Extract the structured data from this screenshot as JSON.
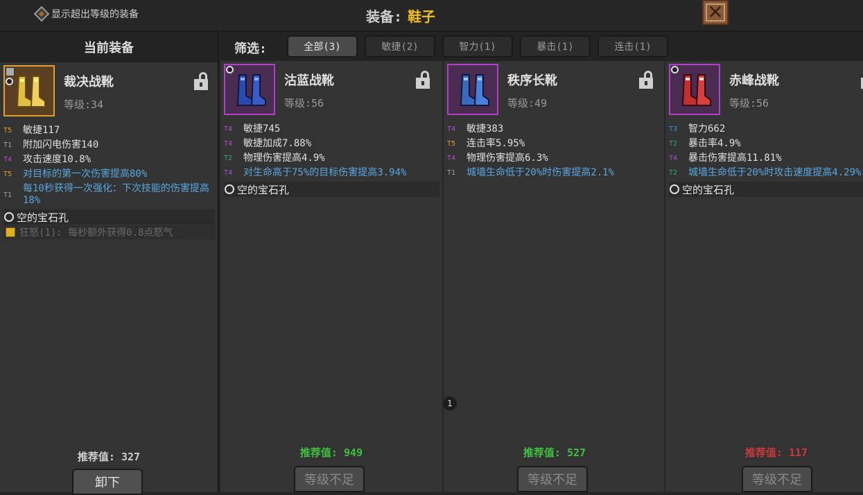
{
  "header": {
    "show_over_level": "显示超出等级的装备",
    "title_label": "装备:",
    "title_value": "鞋子",
    "close_icon": "close-x-icon"
  },
  "left_header": "当前装备",
  "filter": {
    "label": "筛选:",
    "tabs": [
      "全部(3)",
      "敏捷(2)",
      "智力(1)",
      "暴击(1)",
      "连击(1)"
    ],
    "active_index": 0
  },
  "current": {
    "name": "裁决战靴",
    "level": "等级:34",
    "frame_color": "#e0a030",
    "boot_color": "#e0c040",
    "stats": [
      {
        "tier": "T5",
        "text": "敏捷117",
        "style": "white"
      },
      {
        "tier": "T1",
        "text": "附加闪电伤害140",
        "style": "white"
      },
      {
        "tier": "T4",
        "text": "攻击速度10.8%",
        "style": "white"
      },
      {
        "tier": "T5",
        "text": "对目标的第一次伤害提高80%",
        "style": "blue"
      },
      {
        "tier": "T1",
        "text": "每10秒获得一次强化：下次技能的伤害提高18%",
        "style": "blue"
      }
    ],
    "gem": "空的宝石孔",
    "set_bonus": "狂怒(1): 每秒额外获得0.8点怒气",
    "rec_label": "推荐值:",
    "rec_value": "327",
    "rec_color": "#cfcfcf",
    "button": "卸下"
  },
  "candidates": [
    {
      "name": "沽蓝战靴",
      "level": "等级:56",
      "boot_color": "#2a4ab0",
      "stats": [
        {
          "tier": "T4",
          "text": "敏捷745",
          "style": "white"
        },
        {
          "tier": "T4",
          "text": "敏捷加成7.88%",
          "style": "white"
        },
        {
          "tier": "T2",
          "text": "物理伤害提高4.9%",
          "style": "white"
        },
        {
          "tier": "T4",
          "text": "对生命高于75%的目标伤害提高3.94%",
          "style": "blue"
        }
      ],
      "gem": "空的宝石孔",
      "rec_label": "推荐值:",
      "rec_value": "949",
      "rec_color": "#40c040",
      "button": "等级不足"
    },
    {
      "name": "秩序长靴",
      "level": "等级:49",
      "boot_color": "#3a6ac0",
      "stats": [
        {
          "tier": "T4",
          "text": "敏捷383",
          "style": "white"
        },
        {
          "tier": "T5",
          "text": "连击率5.95%",
          "style": "white"
        },
        {
          "tier": "T4",
          "text": "物理伤害提高6.3%",
          "style": "white"
        },
        {
          "tier": "T1",
          "text": "城墙生命低于20%时伤害提高2.1%",
          "style": "blue"
        }
      ],
      "gem": "",
      "rec_label": "推荐值:",
      "rec_value": "527",
      "rec_color": "#40c040",
      "button": "等级不足"
    },
    {
      "name": "赤峰战靴",
      "level": "等级:56",
      "boot_color": "#c03030",
      "stats": [
        {
          "tier": "T3",
          "text": "智力662",
          "style": "white"
        },
        {
          "tier": "T2",
          "text": "暴击率4.9%",
          "style": "white"
        },
        {
          "tier": "T4",
          "text": "暴击伤害提高11.81%",
          "style": "white"
        },
        {
          "tier": "T2",
          "text": "城墙生命低于20%时攻击速度提高4.29%",
          "style": "blue"
        }
      ],
      "gem": "空的宝石孔",
      "rec_label": "推荐值:",
      "rec_value": "117",
      "rec_color": "#c83a3a",
      "button": "等级不足"
    }
  ],
  "page_badge": "1"
}
